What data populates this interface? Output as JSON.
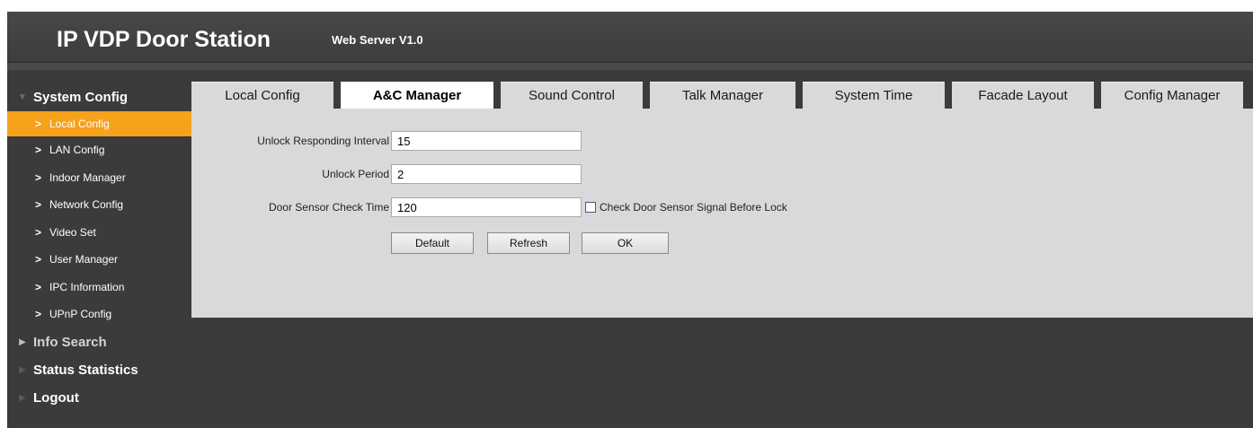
{
  "header": {
    "title": "IP VDP Door Station",
    "subtitle": "Web Server V1.0"
  },
  "sidebar": {
    "groups": [
      {
        "label": "System Config",
        "expanded": true,
        "items": [
          {
            "label": "Local Config",
            "active": true
          },
          {
            "label": "LAN Config"
          },
          {
            "label": "Indoor Manager"
          },
          {
            "label": "Network Config"
          },
          {
            "label": "Video Set"
          },
          {
            "label": "User Manager"
          },
          {
            "label": "IPC Information"
          },
          {
            "label": "UPnP Config"
          }
        ]
      },
      {
        "label": "Info Search"
      },
      {
        "label": "Status Statistics"
      },
      {
        "label": "Logout"
      }
    ]
  },
  "tabs": [
    {
      "label": "Local Config"
    },
    {
      "label": "A&C Manager",
      "active": true
    },
    {
      "label": "Sound Control"
    },
    {
      "label": "Talk Manager"
    },
    {
      "label": "System Time"
    },
    {
      "label": "Facade Layout"
    },
    {
      "label": "Config Manager"
    }
  ],
  "form": {
    "unlock_interval_label": "Unlock Responding Interval",
    "unlock_interval_value": "15",
    "unlock_period_label": "Unlock Period",
    "unlock_period_value": "2",
    "door_sensor_label": "Door Sensor Check Time",
    "door_sensor_value": "120",
    "check_sensor_label": "Check Door Sensor Signal Before Lock",
    "check_sensor_checked": false
  },
  "buttons": {
    "default_label": "Default",
    "refresh_label": "Refresh",
    "ok_label": "OK"
  },
  "colors": {
    "accent": "#f7a21b",
    "background": "#3b3b3b",
    "panel": "#d9d9d9"
  },
  "icons": {
    "expanded": "triangle-down-icon",
    "collapsed": "triangle-right-icon",
    "sub_item": "chevron-right-icon"
  }
}
